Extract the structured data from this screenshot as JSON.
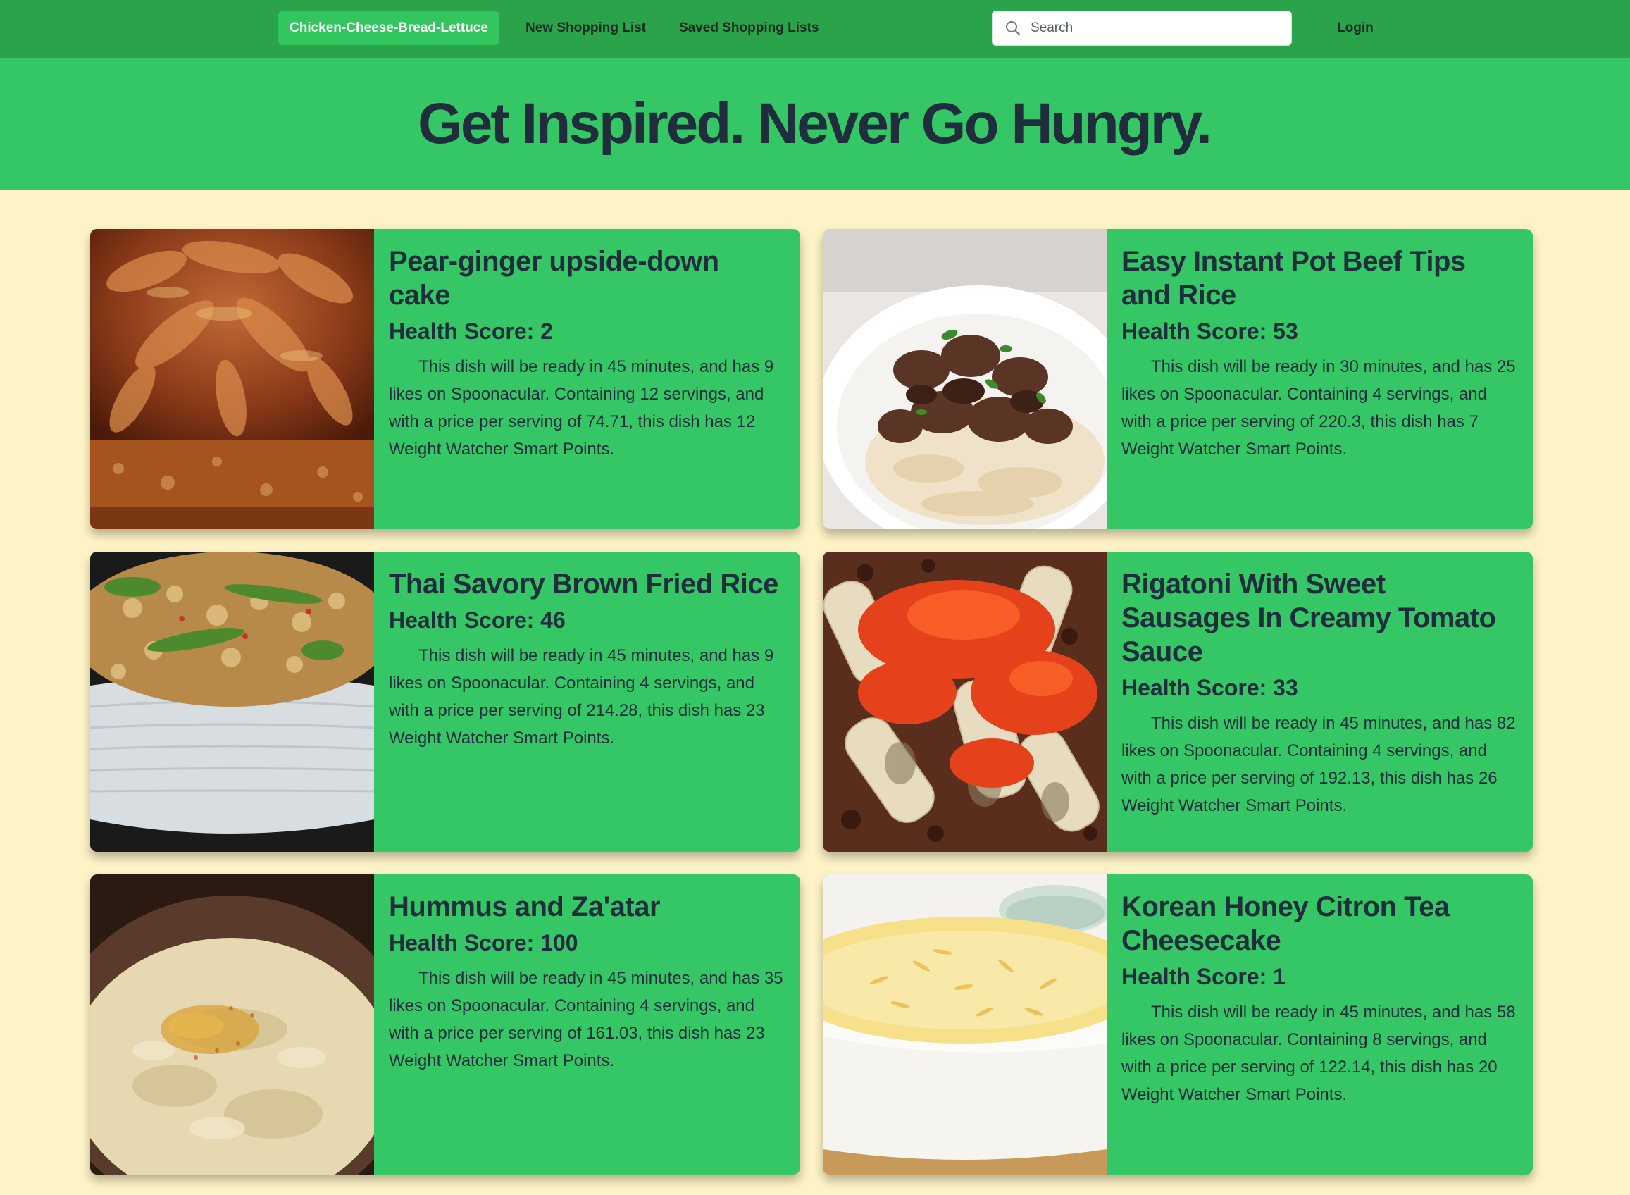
{
  "nav": {
    "brand": "Chicken-Cheese-Bread-Lettuce",
    "new_list": "New Shopping List",
    "saved_lists": "Saved Shopping Lists",
    "search_placeholder": "Search",
    "login": "Login"
  },
  "hero": {
    "headline": "Get Inspired. Never Go Hungry."
  },
  "recipes": [
    {
      "title": "Pear-ginger upside-down cake",
      "health_score": "Health Score: 2",
      "description": "This dish will be ready in 45 minutes, and has 9 likes on Spoonacular. Containing 12 servings, and with a price per serving of 74.71, this dish has 12 Weight Watcher Smart Points.",
      "image": "pear-ginger-cake-photo"
    },
    {
      "title": "Easy Instant Pot Beef Tips and Rice",
      "health_score": "Health Score: 53",
      "description": "This dish will be ready in 30 minutes, and has 25 likes on Spoonacular. Containing 4 servings, and with a price per serving of 220.3, this dish has 7 Weight Watcher Smart Points.",
      "image": "beef-tips-rice-photo"
    },
    {
      "title": "Thai Savory Brown Fried Rice",
      "health_score": "Health Score: 46",
      "description": "This dish will be ready in 45 minutes, and has 9 likes on Spoonacular. Containing 4 servings, and with a price per serving of 214.28, this dish has 23 Weight Watcher Smart Points.",
      "image": "fried-rice-photo"
    },
    {
      "title": "Rigatoni With Sweet Sausages In Creamy Tomato Sauce",
      "health_score": "Health Score: 33",
      "description": "This dish will be ready in 45 minutes, and has 82 likes on Spoonacular. Containing 4 servings, and with a price per serving of 192.13, this dish has 26 Weight Watcher Smart Points.",
      "image": "rigatoni-photo"
    },
    {
      "title": "Hummus and Za'atar",
      "health_score": "Health Score: 100",
      "description": "This dish will be ready in 45 minutes, and has 35 likes on Spoonacular. Containing 4 servings, and with a price per serving of 161.03, this dish has 23 Weight Watcher Smart Points.",
      "image": "hummus-photo"
    },
    {
      "title": "Korean Honey Citron Tea Cheesecake",
      "health_score": "Health Score: 1",
      "description": "This dish will be ready in 45 minutes, and has 58 likes on Spoonacular. Containing 8 servings, and with a price per serving of 122.14, this dish has 20 Weight Watcher Smart Points.",
      "image": "cheesecake-photo"
    }
  ],
  "colors": {
    "navbar": "#2aa34a",
    "brand_button": "#34c65e",
    "hero": "#35c765",
    "card": "#35c765",
    "page_background": "#fdf3c6",
    "text": "#1f2d3d"
  }
}
